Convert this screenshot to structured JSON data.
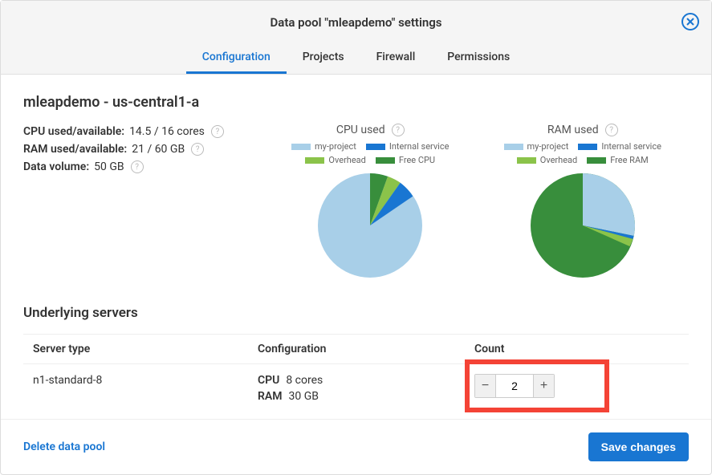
{
  "dialog": {
    "title": "Data pool \"mleapdemo\" settings"
  },
  "tabs": [
    {
      "label": "Configuration",
      "active": true
    },
    {
      "label": "Projects",
      "active": false
    },
    {
      "label": "Firewall",
      "active": false
    },
    {
      "label": "Permissions",
      "active": false
    }
  ],
  "pool": {
    "heading": "mleapdemo - us-central1-a",
    "cpu_label": "CPU used/available:",
    "cpu_value": "14.5 / 16 cores",
    "ram_label": "RAM used/available:",
    "ram_value": "21 / 60 GB",
    "volume_label": "Data volume:",
    "volume_value": "50 GB"
  },
  "charts": {
    "cpu": {
      "title": "CPU used",
      "legend": [
        {
          "label": "my-project",
          "color": "#a8cfe8"
        },
        {
          "label": "Internal service",
          "color": "#1976d2"
        },
        {
          "label": "Overhead",
          "color": "#8bc34a"
        },
        {
          "label": "Free CPU",
          "color": "#388e3c"
        }
      ]
    },
    "ram": {
      "title": "RAM used",
      "legend": [
        {
          "label": "my-project",
          "color": "#a8cfe8"
        },
        {
          "label": "Internal service",
          "color": "#1976d2"
        },
        {
          "label": "Overhead",
          "color": "#8bc34a"
        },
        {
          "label": "Free RAM",
          "color": "#388e3c"
        }
      ]
    }
  },
  "chart_data": [
    {
      "type": "pie",
      "title": "CPU used",
      "series": [
        {
          "name": "my-project",
          "value": 12.5
        },
        {
          "name": "Internal service",
          "value": 1.2
        },
        {
          "name": "Overhead",
          "value": 0.8
        },
        {
          "name": "Free CPU",
          "value": 1.5
        }
      ],
      "unit": "cores",
      "total": 16
    },
    {
      "type": "pie",
      "title": "RAM used",
      "series": [
        {
          "name": "my-project",
          "value": 19
        },
        {
          "name": "Internal service",
          "value": 0.5
        },
        {
          "name": "Overhead",
          "value": 1.5
        },
        {
          "name": "Free RAM",
          "value": 39
        }
      ],
      "unit": "GB",
      "total": 60
    }
  ],
  "servers": {
    "heading": "Underlying servers",
    "columns": {
      "type": "Server type",
      "config": "Configuration",
      "count": "Count"
    },
    "rows": [
      {
        "type": "n1-standard-8",
        "cpu_label": "CPU",
        "cpu_value": "8 cores",
        "ram_label": "RAM",
        "ram_value": "30 GB",
        "count": "2"
      }
    ]
  },
  "actions": {
    "delete": "Delete data pool",
    "save": "Save changes"
  }
}
